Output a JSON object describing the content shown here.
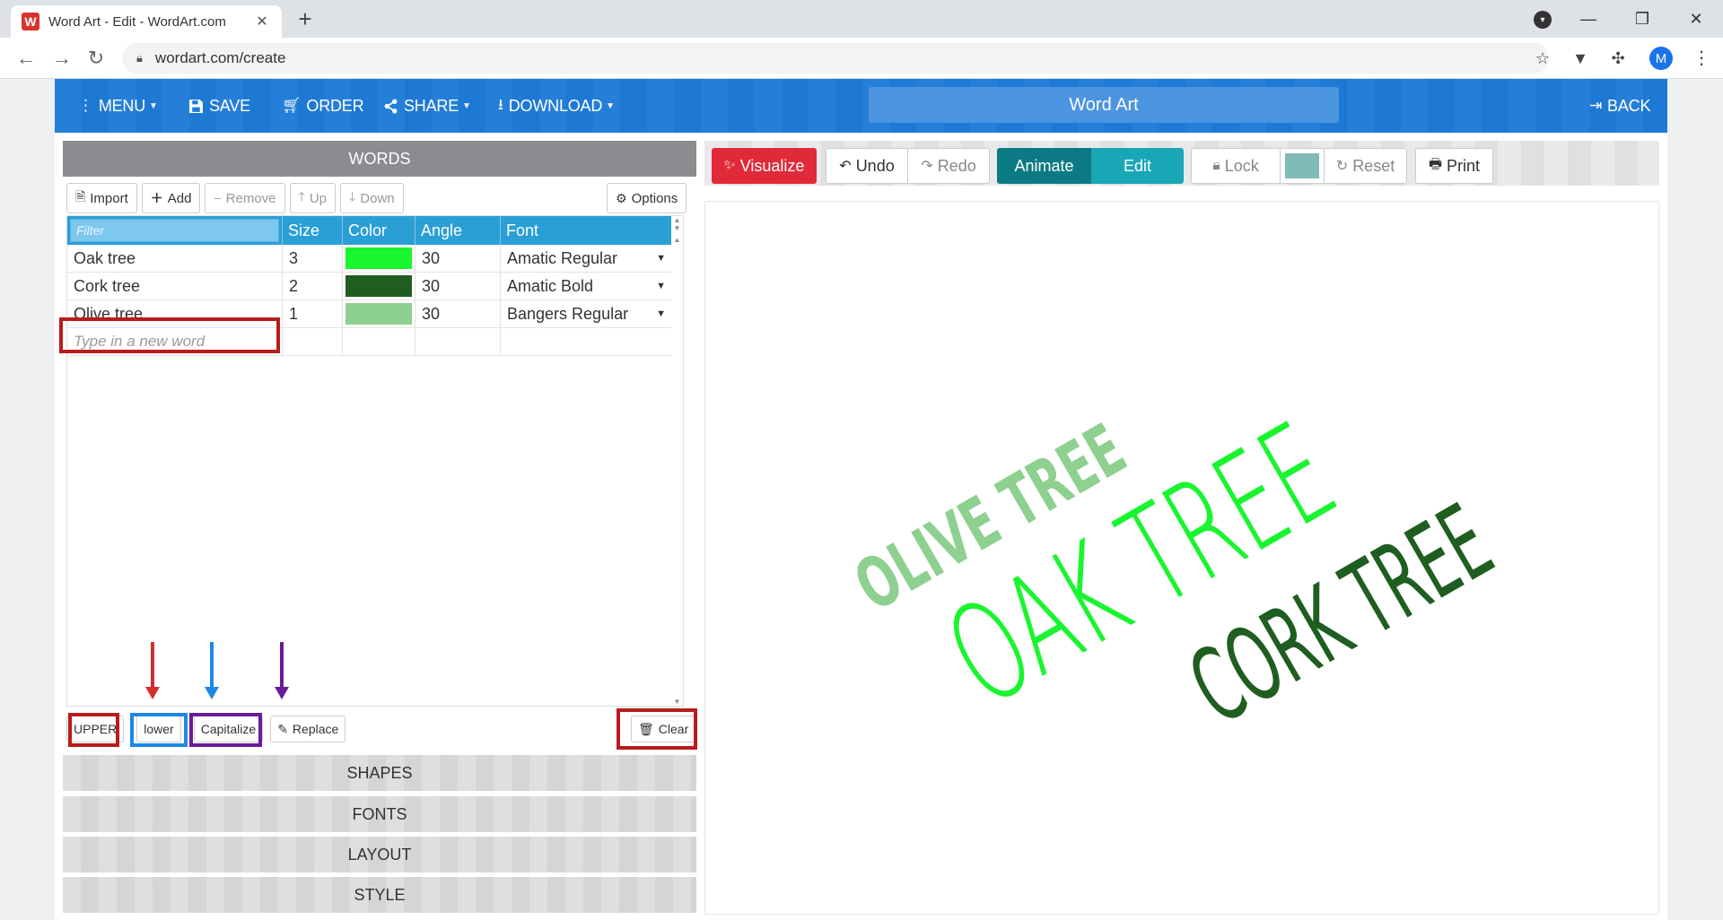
{
  "browser": {
    "tab_title": "Word Art - Edit - WordArt.com",
    "favicon_letter": "W",
    "url": "wordart.com/create",
    "avatar_letter": "M"
  },
  "header": {
    "menu": "MENU",
    "save": "SAVE",
    "order": "ORDER",
    "share": "SHARE",
    "download": "DOWNLOAD",
    "title": "Word Art",
    "back": "BACK"
  },
  "words": {
    "heading": "WORDS",
    "toolbar": {
      "import": "Import",
      "add": "Add",
      "remove": "Remove",
      "up": "Up",
      "down": "Down",
      "options": "Options"
    },
    "filter_placeholder": "Filter",
    "columns": {
      "size": "Size",
      "color": "Color",
      "angle": "Angle",
      "font": "Font"
    },
    "rows": [
      {
        "word": "Oak tree",
        "size": "3",
        "color": "#19f52e",
        "angle": "30",
        "font": "Amatic Regular"
      },
      {
        "word": "Cork tree",
        "size": "2",
        "color": "#1f5e20",
        "angle": "30",
        "font": "Amatic Bold"
      },
      {
        "word": "Olive tree",
        "size": "1",
        "color": "#8ed08f",
        "angle": "30",
        "font": "Bangers Regular"
      }
    ],
    "new_word_placeholder": "Type in a new word",
    "case_buttons": {
      "upper": "UPPER",
      "lower": "lower",
      "capitalize": "Capitalize",
      "replace": "Replace",
      "clear": "Clear"
    }
  },
  "sections": {
    "shapes": "SHAPES",
    "fonts": "FONTS",
    "layout": "LAYOUT",
    "style": "STYLE"
  },
  "right_toolbar": {
    "visualize": "Visualize",
    "undo": "Undo",
    "redo": "Redo",
    "animate": "Animate",
    "edit": "Edit",
    "lock": "Lock",
    "reset": "Reset",
    "print": "Print",
    "lock_color": "#7fbab8"
  },
  "canvas_words": {
    "olive": "OLIVE TREE",
    "oak": "OAK TREE",
    "cork": "CORK TREE"
  },
  "colors": {
    "header_blue": "#1e7bd8",
    "table_header_blue": "#2a9fd6",
    "visualize_red": "#e02a3a",
    "animate_teal": "#0b7a83",
    "edit_teal": "#1aa7b5",
    "highlight_red": "#b71c1c",
    "highlight_blue": "#1e88e5",
    "highlight_purple": "#6a1b9a"
  }
}
